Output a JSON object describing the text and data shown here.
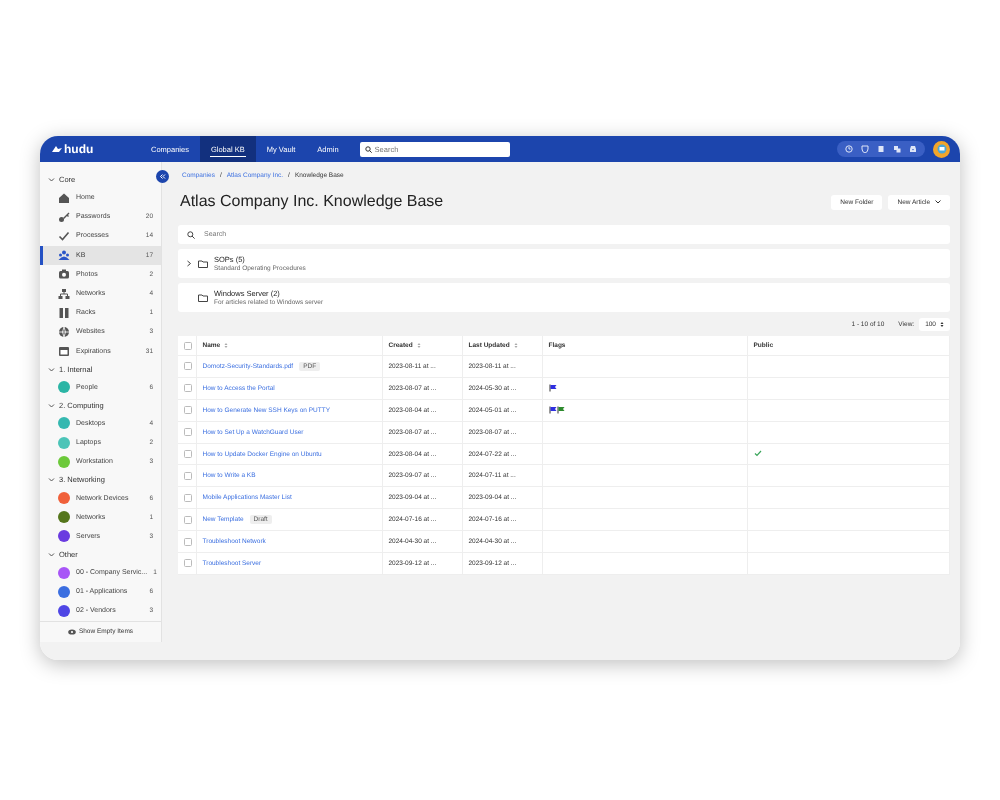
{
  "nav": {
    "logo": "hudu",
    "items": [
      {
        "label": "Companies",
        "selected": false
      },
      {
        "label": "Global KB",
        "selected": true
      },
      {
        "label": "My Vault",
        "selected": false
      },
      {
        "label": "Admin",
        "selected": false
      }
    ],
    "search": {
      "placeholder": "Search"
    }
  },
  "sidebar": {
    "sections": [
      {
        "title": "Core",
        "expanded": true,
        "items": [
          {
            "label": "Home",
            "selected": false
          },
          {
            "label": "Passwords",
            "count": "20",
            "selected": false
          },
          {
            "label": "Processes",
            "count": "14",
            "selected": false
          },
          {
            "label": "KB",
            "count": "17",
            "selected": true
          },
          {
            "label": "Photos",
            "count": "2",
            "selected": false
          },
          {
            "label": "Networks",
            "count": "4",
            "selected": false
          },
          {
            "label": "Racks",
            "count": "1",
            "selected": false
          },
          {
            "label": "Websites",
            "count": "3",
            "selected": false
          },
          {
            "label": "Expirations",
            "count": "31",
            "selected": false
          }
        ]
      },
      {
        "title": "1. Internal",
        "expanded": true,
        "items": [
          {
            "label": "People",
            "count": "6",
            "selected": false,
            "color": "#2bb5a5"
          }
        ]
      },
      {
        "title": "2. Computing",
        "expanded": true,
        "items": [
          {
            "label": "Desktops",
            "count": "4",
            "selected": false,
            "color": "#35b8b0"
          },
          {
            "label": "Laptops",
            "count": "2",
            "selected": false,
            "color": "#4cc4b8"
          },
          {
            "label": "Workstation",
            "count": "3",
            "selected": false,
            "color": "#6cc93a"
          }
        ]
      },
      {
        "title": "3. Networking",
        "expanded": true,
        "items": [
          {
            "label": "Network Devices",
            "count": "6",
            "selected": false,
            "color": "#f0603a"
          },
          {
            "label": "Networks",
            "count": "1",
            "selected": false,
            "color": "#55761c"
          },
          {
            "label": "Servers",
            "count": "3",
            "selected": false,
            "color": "#6a3be0"
          }
        ]
      },
      {
        "title": "Other",
        "expanded": true,
        "items": [
          {
            "label": "00 - Company Servic...",
            "count": "1",
            "selected": false,
            "color": "#a855f7"
          },
          {
            "label": "01 - Applications",
            "count": "6",
            "selected": false,
            "color": "#3b6ee0"
          },
          {
            "label": "02 - Vendors",
            "count": "3",
            "selected": false,
            "color": "#4f46e5"
          }
        ]
      }
    ],
    "footer": "Show Empty Items"
  },
  "breadcrumb": [
    {
      "kind": "link",
      "label": "Companies"
    },
    {
      "kind": "separator",
      "label": "/"
    },
    {
      "kind": "link",
      "label": "Atlas Company Inc."
    },
    {
      "kind": "separator",
      "label": "/"
    },
    {
      "kind": "current",
      "label": "Knowledge Base"
    }
  ],
  "title": "Atlas Company Inc. Knowledge Base",
  "buttons": [
    "New Folder",
    "New Article"
  ],
  "search": {
    "placeholder": "Search"
  },
  "folders": [
    {
      "name": "SOPs (5)",
      "description": "Standard Operating Procedures",
      "expandable": true
    },
    {
      "name": "Windows Server (2)",
      "description": "For articles related to Windows server",
      "expandable": false
    }
  ],
  "pagination": {
    "range": "1 - 10 of 10",
    "view_label": "View:",
    "per_page": "100"
  },
  "table": {
    "select_all_checked": false,
    "columns": [
      "Name",
      "Created",
      "Last Updated",
      "Flags",
      "Public"
    ],
    "rows": [
      {
        "name": "Domotz-Security-Standards.pdf",
        "badge": "PDF",
        "created": "2023-08-11 at ...",
        "updated": "2023-08-11 at ...",
        "flags": [],
        "public": false,
        "checked": false
      },
      {
        "name": "How to Access the Portal",
        "created": "2023-08-07 at ...",
        "updated": "2024-05-30 at ...",
        "flags": [
          {
            "color": "#2f2fe0"
          }
        ],
        "public": false,
        "checked": false
      },
      {
        "name": "How to Generate New SSH Keys on PUTTY",
        "created": "2023-08-04 at ...",
        "updated": "2024-05-01 at ...",
        "flags": [
          {
            "color": "#2f2fe0"
          },
          {
            "color": "#2e8b2e"
          }
        ],
        "public": false,
        "checked": false
      },
      {
        "name": "How to Set Up a WatchGuard User",
        "created": "2023-08-07 at ...",
        "updated": "2023-08-07 at ...",
        "flags": [],
        "public": false,
        "checked": false
      },
      {
        "name": "How to Update Docker Engine on Ubuntu",
        "created": "2023-08-04 at ...",
        "updated": "2024-07-22 at ...",
        "flags": [],
        "public": true,
        "checked": false
      },
      {
        "name": "How to Write a KB",
        "created": "2023-09-07 at ...",
        "updated": "2024-07-11 at ...",
        "flags": [],
        "public": false,
        "checked": false
      },
      {
        "name": "Mobile Applications Master List",
        "created": "2023-09-04 at ...",
        "updated": "2023-09-04 at ...",
        "flags": [],
        "public": false,
        "checked": false
      },
      {
        "name": "New Template",
        "badge": "Draft",
        "created": "2024-07-16 at ...",
        "updated": "2024-07-16 at ...",
        "flags": [],
        "public": false,
        "checked": false
      },
      {
        "name": "Troubleshoot Network",
        "created": "2024-04-30 at ...",
        "updated": "2024-04-30 at ...",
        "flags": [],
        "public": false,
        "checked": false
      },
      {
        "name": "Troubleshoot Server",
        "created": "2023-09-12 at ...",
        "updated": "2023-09-12 at ...",
        "flags": [],
        "public": false,
        "checked": false
      }
    ]
  }
}
